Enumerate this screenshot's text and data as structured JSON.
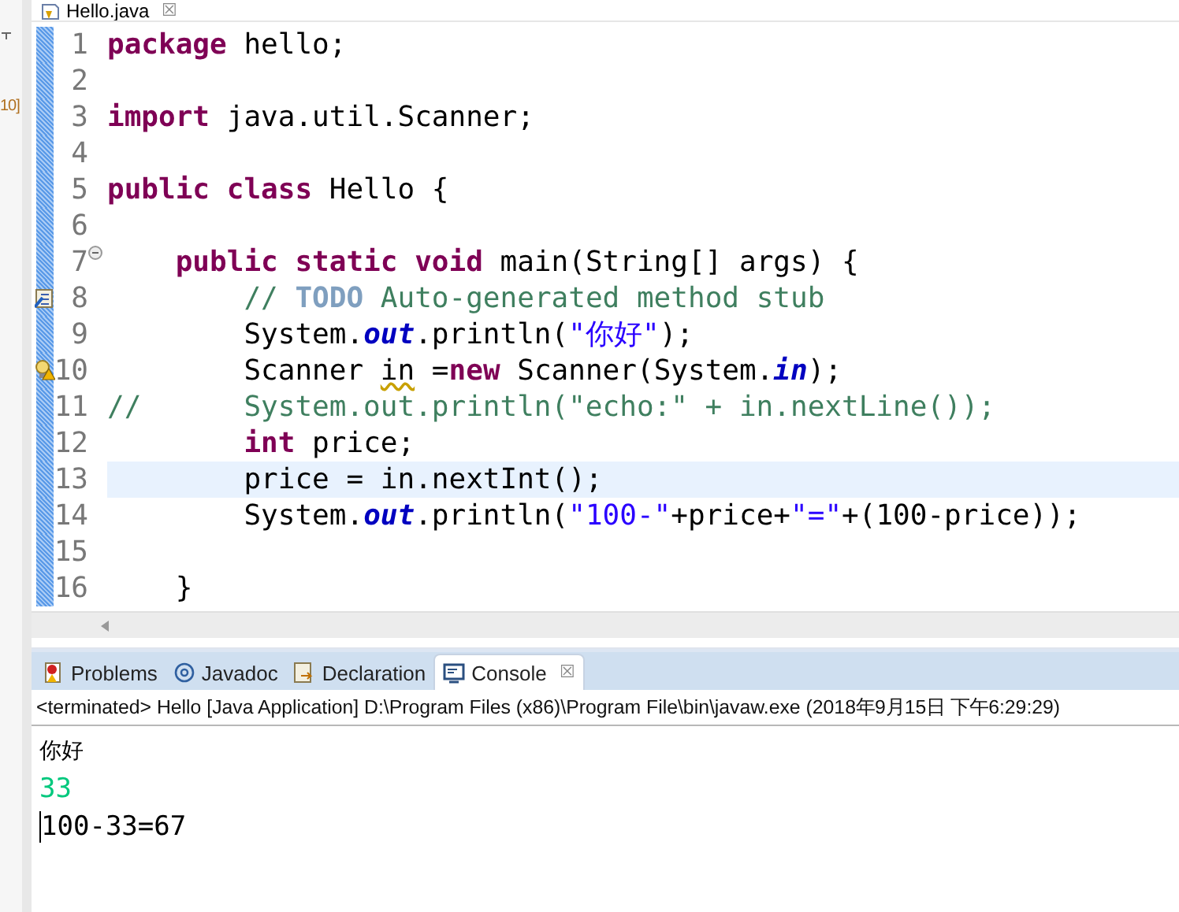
{
  "left_strip": {
    "label": "10]"
  },
  "editor": {
    "tab": {
      "label": "Hello.java",
      "close": "☒"
    },
    "lines": [
      {
        "number": "1",
        "current": false,
        "task": false,
        "warning": false,
        "tokens": [
          {
            "kind": "keyword",
            "text": "package"
          },
          {
            "kind": "plain",
            "text": " hello;"
          }
        ]
      },
      {
        "number": "2",
        "current": false,
        "task": false,
        "warning": false
      },
      {
        "number": "3",
        "current": false,
        "task": false,
        "warning": false,
        "tokens": [
          {
            "kind": "keyword",
            "text": "import"
          },
          {
            "kind": "plain",
            "text": " java.util.Scanner;"
          }
        ]
      },
      {
        "number": "4",
        "current": false,
        "task": false,
        "warning": false
      },
      {
        "number": "5",
        "current": false,
        "task": false,
        "warning": false,
        "tokens": [
          {
            "kind": "keyword",
            "text": "public class"
          },
          {
            "kind": "plain",
            "text": " Hello {"
          }
        ]
      },
      {
        "number": "6",
        "current": false,
        "task": false,
        "warning": false
      },
      {
        "number": "7",
        "current": false,
        "task": false,
        "warning": false,
        "expanded": true,
        "tokens": [
          {
            "kind": "keyword",
            "text": "    public static void"
          },
          {
            "kind": "plain",
            "text": " main(String[] args) {"
          }
        ]
      },
      {
        "number": "8",
        "current": false,
        "task": true,
        "warning": false,
        "tokens": [
          {
            "kind": "comment",
            "text": "        // "
          },
          {
            "kind": "todo",
            "text": "TODO"
          },
          {
            "kind": "comment",
            "text": " Auto-generated method stub"
          }
        ]
      },
      {
        "number": "9",
        "current": false,
        "task": false,
        "warning": false,
        "tokens": [
          {
            "kind": "plain",
            "text": "        System."
          },
          {
            "kind": "field",
            "text": "out"
          },
          {
            "kind": "plain",
            "text": ".println("
          },
          {
            "kind": "string",
            "text": "\"你好\""
          },
          {
            "kind": "plain",
            "text": ");"
          }
        ]
      },
      {
        "number": "10",
        "current": false,
        "task": false,
        "warning": true,
        "tokens": [
          {
            "kind": "plain",
            "text": "        Scanner "
          },
          {
            "kind": "warning",
            "text": "in"
          },
          {
            "kind": "plain",
            "text": " ="
          },
          {
            "kind": "keyword",
            "text": "new"
          },
          {
            "kind": "plain",
            "text": " Scanner(System."
          },
          {
            "kind": "field",
            "text": "in"
          },
          {
            "kind": "plain",
            "text": ");"
          }
        ]
      },
      {
        "number": "11",
        "current": false,
        "task": false,
        "warning": false,
        "tokens": [
          {
            "kind": "comment",
            "text": "//      System.out.println(\"echo:\" + in.nextLine());"
          }
        ]
      },
      {
        "number": "12",
        "current": false,
        "task": false,
        "warning": false,
        "tokens": [
          {
            "kind": "keyword",
            "text": "        int"
          },
          {
            "kind": "plain",
            "text": " price;"
          }
        ]
      },
      {
        "number": "13",
        "current": true,
        "task": false,
        "warning": false,
        "tokens": [
          {
            "kind": "plain",
            "text": "        price = in.nextInt();"
          }
        ]
      },
      {
        "number": "14",
        "current": false,
        "task": false,
        "warning": false,
        "tokens": [
          {
            "kind": "plain",
            "text": "        System."
          },
          {
            "kind": "field",
            "text": "out"
          },
          {
            "kind": "plain",
            "text": ".println("
          },
          {
            "kind": "string",
            "text": "\"100-\""
          },
          {
            "kind": "plain",
            "text": "+price+"
          },
          {
            "kind": "string",
            "text": "\"=\""
          },
          {
            "kind": "plain",
            "text": "+(100-price));"
          }
        ]
      },
      {
        "number": "15",
        "current": false,
        "task": false,
        "warning": false
      },
      {
        "number": "16",
        "current": false,
        "task": false,
        "warning": false,
        "tokens": [
          {
            "kind": "plain",
            "text": "    }"
          }
        ]
      }
    ]
  },
  "panel": {
    "tabs": [
      {
        "label": "Problems",
        "selected": false
      },
      {
        "label": "Javadoc",
        "selected": false
      },
      {
        "label": "Declaration",
        "selected": false
      },
      {
        "label": "Console",
        "selected": true,
        "close": "☒"
      }
    ],
    "console": {
      "header": "<terminated> Hello [Java Application] D:\\Program Files (x86)\\Program File\\bin\\javaw.exe (2018年9月15日 下午6:29:29)",
      "output": [
        {
          "kind": "output",
          "text": "你好"
        },
        {
          "kind": "input",
          "text": "33"
        },
        {
          "kind": "output",
          "text": "100-33=67"
        }
      ]
    }
  }
}
